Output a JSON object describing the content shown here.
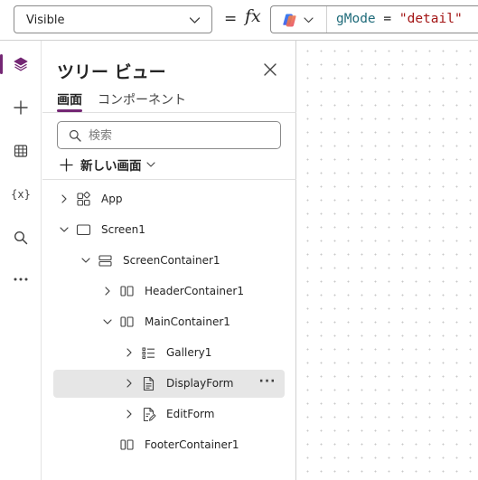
{
  "formula_bar": {
    "property": "Visible",
    "equals": "=",
    "fx": "fx",
    "formula_variable": "gMode",
    "formula_operator": " = ",
    "formula_string": "\"detail\""
  },
  "rail": {
    "items": [
      "layers-icon",
      "plus-icon",
      "table-icon",
      "variables-icon",
      "search-icon",
      "more-icon"
    ],
    "variables_text": "{x}"
  },
  "tree_panel": {
    "title": "ツリー ビュー",
    "tabs": [
      {
        "label": "画面",
        "selected": true
      },
      {
        "label": "コンポーネント",
        "selected": false
      }
    ],
    "search_placeholder": "検索",
    "new_screen_label": "新しい画面",
    "nodes": [
      {
        "label": "App",
        "icon": "app-icon",
        "expander": "collapsed"
      },
      {
        "label": "Screen1",
        "icon": "screen-icon",
        "expander": "expanded"
      },
      {
        "label": "ScreenContainer1",
        "icon": "vertical-container-icon",
        "expander": "expanded"
      },
      {
        "label": "HeaderContainer1",
        "icon": "horizontal-container-icon",
        "expander": "collapsed"
      },
      {
        "label": "MainContainer1",
        "icon": "horizontal-container-icon",
        "expander": "expanded"
      },
      {
        "label": "Gallery1",
        "icon": "gallery-icon",
        "expander": "collapsed"
      },
      {
        "label": "DisplayForm",
        "icon": "display-form-icon",
        "expander": "collapsed",
        "selected": true,
        "more": "···"
      },
      {
        "label": "EditForm",
        "icon": "edit-form-icon",
        "expander": "collapsed"
      },
      {
        "label": "FooterContainer1",
        "icon": "horizontal-container-icon",
        "expander": "none"
      }
    ]
  },
  "colors": {
    "accent": "#742774",
    "selected_row": "#e6e6e6",
    "formula_variable": "#1f6b7a",
    "formula_string": "#a31515"
  }
}
